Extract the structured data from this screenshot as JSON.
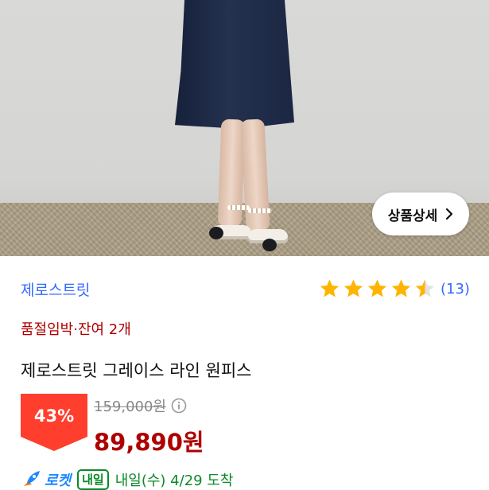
{
  "photo": {
    "detail_button_label": "상품상세",
    "detail_button_icon": "chevron-right-icon"
  },
  "product": {
    "brand": "제로스트릿",
    "rating_stars": 4.5,
    "review_count": "(13)",
    "urgency": "품절임박·잔여 2개",
    "title": "제로스트릿 그레이스 라인 원피스"
  },
  "pricing": {
    "discount": "43%",
    "original_price": "159,000원",
    "sale_price": "89,890원"
  },
  "delivery": {
    "badge_rocket": "로켓",
    "badge_nail": "내일",
    "text": "내일(수) 4/29 도착"
  },
  "colors": {
    "brand_blue": "#346aff",
    "price_red": "#ae0000",
    "discount_badge": "#ff3e2d",
    "star": "#ffb400",
    "delivery_green": "#0a8a28"
  }
}
